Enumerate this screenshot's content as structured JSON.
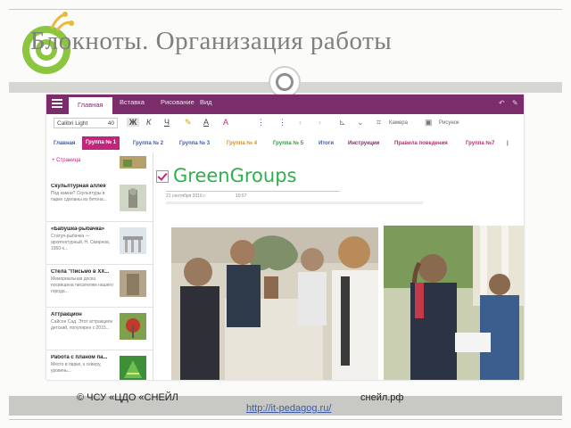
{
  "slide": {
    "title": "Блокноты. Организация работы",
    "footer_left": "© ЧСУ «ЦДО «СНЕЙЛ",
    "footer_right": "снейл.рф",
    "footer_link": "http://it-pedagog.ru/"
  },
  "app": {
    "ribbon_tabs": [
      "Главная",
      "Вставка",
      "Рисование",
      "Вид"
    ],
    "active_tab": "Главная",
    "toolbar": {
      "font_name": "Calibri Light",
      "font_size": "40",
      "bold": "Ж",
      "italic": "К",
      "underline": "Ч",
      "highlight": "✎",
      "font_color": "A",
      "clear_format": "A",
      "camera_label": "Камера",
      "picture_label": "Рисунок"
    },
    "sections": [
      {
        "label": "Главная",
        "color": "#3b5aa8"
      },
      {
        "label": "Группа № 1",
        "color": "#ffffff"
      },
      {
        "label": "Группа № 2",
        "color": "#3b5aa8"
      },
      {
        "label": "Группа № 3",
        "color": "#3b5aa8"
      },
      {
        "label": "Группа № 4",
        "color": "#d98c1e"
      },
      {
        "label": "Группа № 5",
        "color": "#2b9a3e"
      },
      {
        "label": "Итоги",
        "color": "#3b5aa8"
      },
      {
        "label": "Инструкции",
        "color": "#7b2c6a"
      },
      {
        "label": "Правила поведения",
        "color": "#c0267b"
      },
      {
        "label": "Группа №7",
        "color": "#c0267b"
      }
    ],
    "active_section": "Группа № 1",
    "add_page_label": "+ Страница",
    "pages": [
      {
        "title": "",
        "snippet": ""
      },
      {
        "title": "Скульптурная аллея",
        "snippet": "Под камни? Скульптуры в парке сделаны из бетона..."
      },
      {
        "title": "«Бабушка-рыбачка»",
        "snippet": "Статуя-рыбачка — архитектурный, Н. Смирнов, 1950-х..."
      },
      {
        "title": "Стела \"Письмо в XX...",
        "snippet": "Мемориальная доска посвящена писателям нашего города..."
      },
      {
        "title": "Аттракцион",
        "snippet": "Сайсон Сад. Этот аттракцион детский, популярен с 2015..."
      },
      {
        "title": "Работа с планом па...",
        "snippet": "Место в парке, к северу, уровень..."
      }
    ],
    "page": {
      "title": "GreenGroups",
      "date": "21 сентября 2016 г.",
      "time": "10:57"
    }
  },
  "colors": {
    "ribbon": "#7b2c6a",
    "accent": "#c0267b",
    "title_green": "#2db14b"
  }
}
